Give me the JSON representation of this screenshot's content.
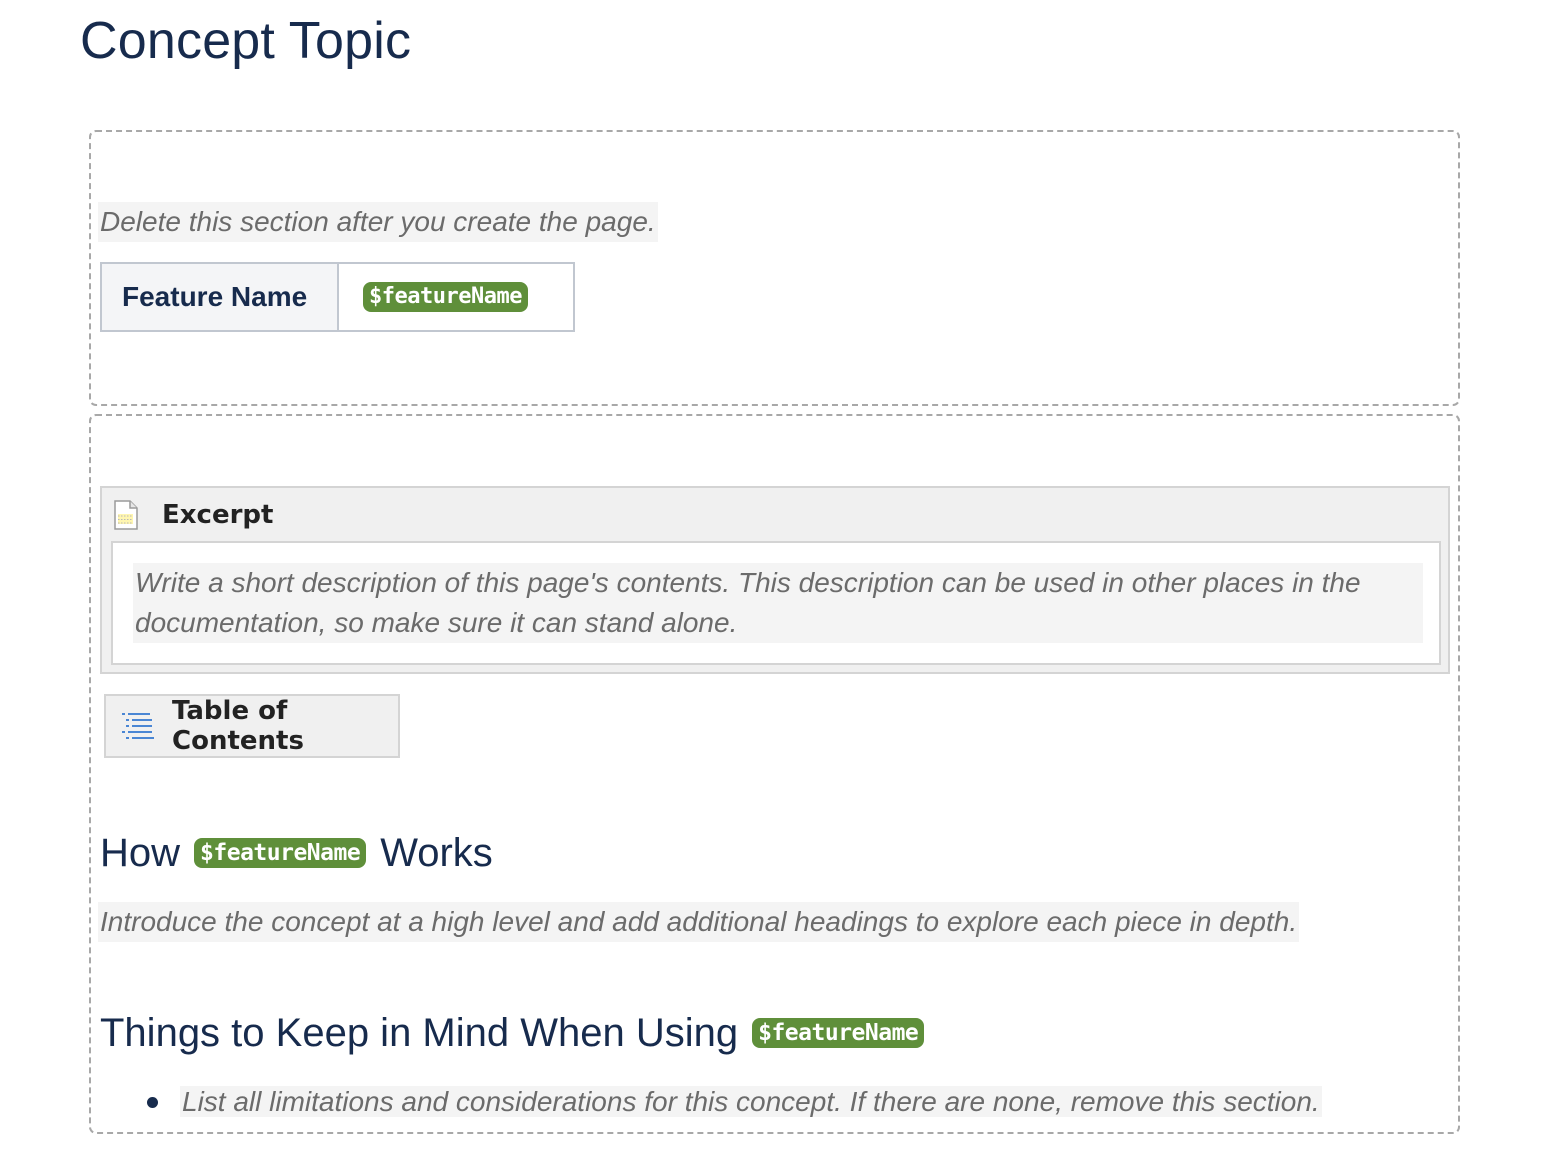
{
  "page": {
    "title": "Concept Topic"
  },
  "setup_section": {
    "instruction": "Delete this section after you create the page.",
    "table": {
      "header": "Feature Name",
      "value": "$featureName"
    }
  },
  "excerpt": {
    "label": "Excerpt",
    "icon": "document-icon",
    "text": "Write a short description of this page's contents. This description can be used in other places in the documentation, so make sure it can stand alone."
  },
  "toc": {
    "label": "Table of Contents",
    "icon": "list-icon"
  },
  "how_section": {
    "heading_prefix": "How",
    "variable": "$featureName",
    "heading_suffix": "Works",
    "instruction": "Introduce the concept at a high level and add additional headings to explore each piece in depth."
  },
  "things_section": {
    "heading_prefix": "Things to Keep in Mind When Using",
    "variable": "$featureName",
    "bullets": [
      "List all limitations and considerations for this concept. If there are none, remove this section."
    ]
  },
  "colors": {
    "text": "#172b4d",
    "variable_bg": "#5f8f3a",
    "instruction_text": "#6b6b6b",
    "instruction_bg": "#f4f4f4",
    "macro_bg": "#f0f0f0"
  }
}
